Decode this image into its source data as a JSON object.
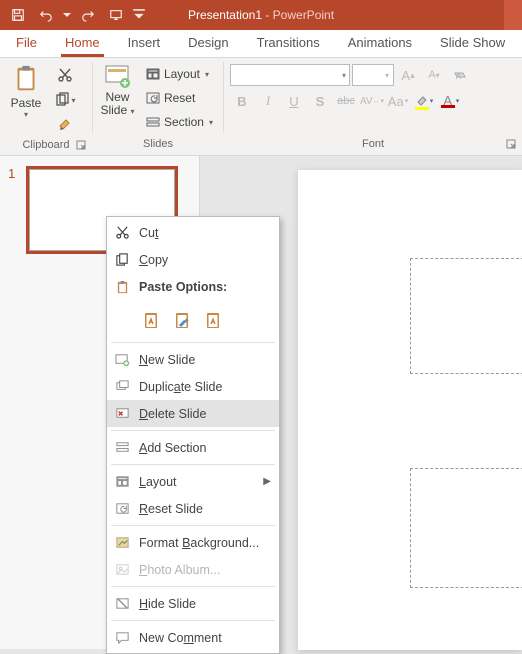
{
  "titlebar": {
    "doc": "Presentation1",
    "sep": " - ",
    "app": "PowerPoint"
  },
  "tabs": {
    "file": "File",
    "home": "Home",
    "insert": "Insert",
    "design": "Design",
    "transitions": "Transitions",
    "animations": "Animations",
    "slideshow": "Slide Show"
  },
  "ribbon": {
    "clipboard": {
      "paste": "Paste",
      "label": "Clipboard"
    },
    "slides": {
      "newslide_l1": "New",
      "newslide_l2": "Slide",
      "layout": "Layout",
      "reset": "Reset",
      "section": "Section",
      "label": "Slides"
    },
    "font": {
      "label": "Font",
      "bold": "B",
      "italic": "I",
      "underline": "U",
      "strike": "S",
      "shadow": "abc",
      "spacing": "AV",
      "case": "Aa"
    }
  },
  "thumb": {
    "num": "1"
  },
  "context_menu": {
    "cut": "Cut",
    "copy": "Copy",
    "paste_options": "Paste Options:",
    "new_slide": "New Slide",
    "duplicate": "Duplicate Slide",
    "delete": "Delete Slide",
    "add_section": "Add Section",
    "layout": "Layout",
    "reset": "Reset Slide",
    "format_bg": "Format Background...",
    "photo_album": "Photo Album...",
    "hide": "Hide Slide",
    "new_comment": "New Comment"
  }
}
